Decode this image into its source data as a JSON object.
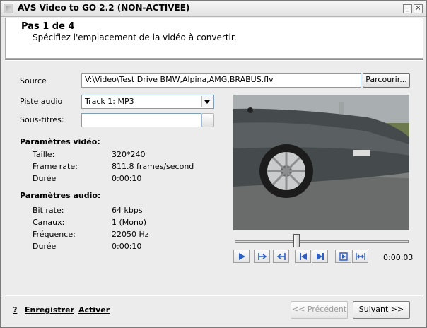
{
  "window": {
    "title": "AVS Video to GO 2.2 (NON-ACTIVEE)",
    "minimize_glyph": "_",
    "close_glyph": "×"
  },
  "header": {
    "step": "Pas 1 de 4",
    "description": "Spécifiez l'emplacement de la vidéo à convertir."
  },
  "source": {
    "label": "Source",
    "value": "V:\\Video\\Test Drive BMW,Alpina,AMG,BRABUS.flv",
    "browse": "Parcourir..."
  },
  "audio_track": {
    "label": "Piste audio",
    "selected": "Track 1: MP3"
  },
  "subtitles": {
    "label": "Sous-titres:",
    "value": ""
  },
  "video_params": {
    "heading": "Paramètres vidéo:",
    "rows": [
      {
        "label": "Taille:",
        "value": "320*240"
      },
      {
        "label": "Frame rate:",
        "value": "811.8 frames/second"
      },
      {
        "label": "Durée",
        "value": "0:00:10"
      }
    ]
  },
  "audio_params": {
    "heading": "Paramètres audio:",
    "rows": [
      {
        "label": "Bit rate:",
        "value": "64 kbps"
      },
      {
        "label": "Canaux:",
        "value": "1 (Mono)"
      },
      {
        "label": "Fréquence:",
        "value": "22050 Hz"
      },
      {
        "label": "Durée",
        "value": "0:00:10"
      }
    ]
  },
  "player": {
    "time": "0:00:03",
    "position_fraction": 0.35,
    "controls": [
      "play-icon",
      "mark-in-icon",
      "mark-out-icon",
      "previous-frame-icon",
      "next-frame-icon",
      "go-to-mark-icon",
      "fit-icon"
    ]
  },
  "footer": {
    "help": "?",
    "register": "Enregistrer",
    "activate": "Activer",
    "previous": "<< Précédent",
    "next": "Suivant >>"
  },
  "colors": {
    "control_blue": "#2c5fc7",
    "window_bg": "#ececec"
  }
}
